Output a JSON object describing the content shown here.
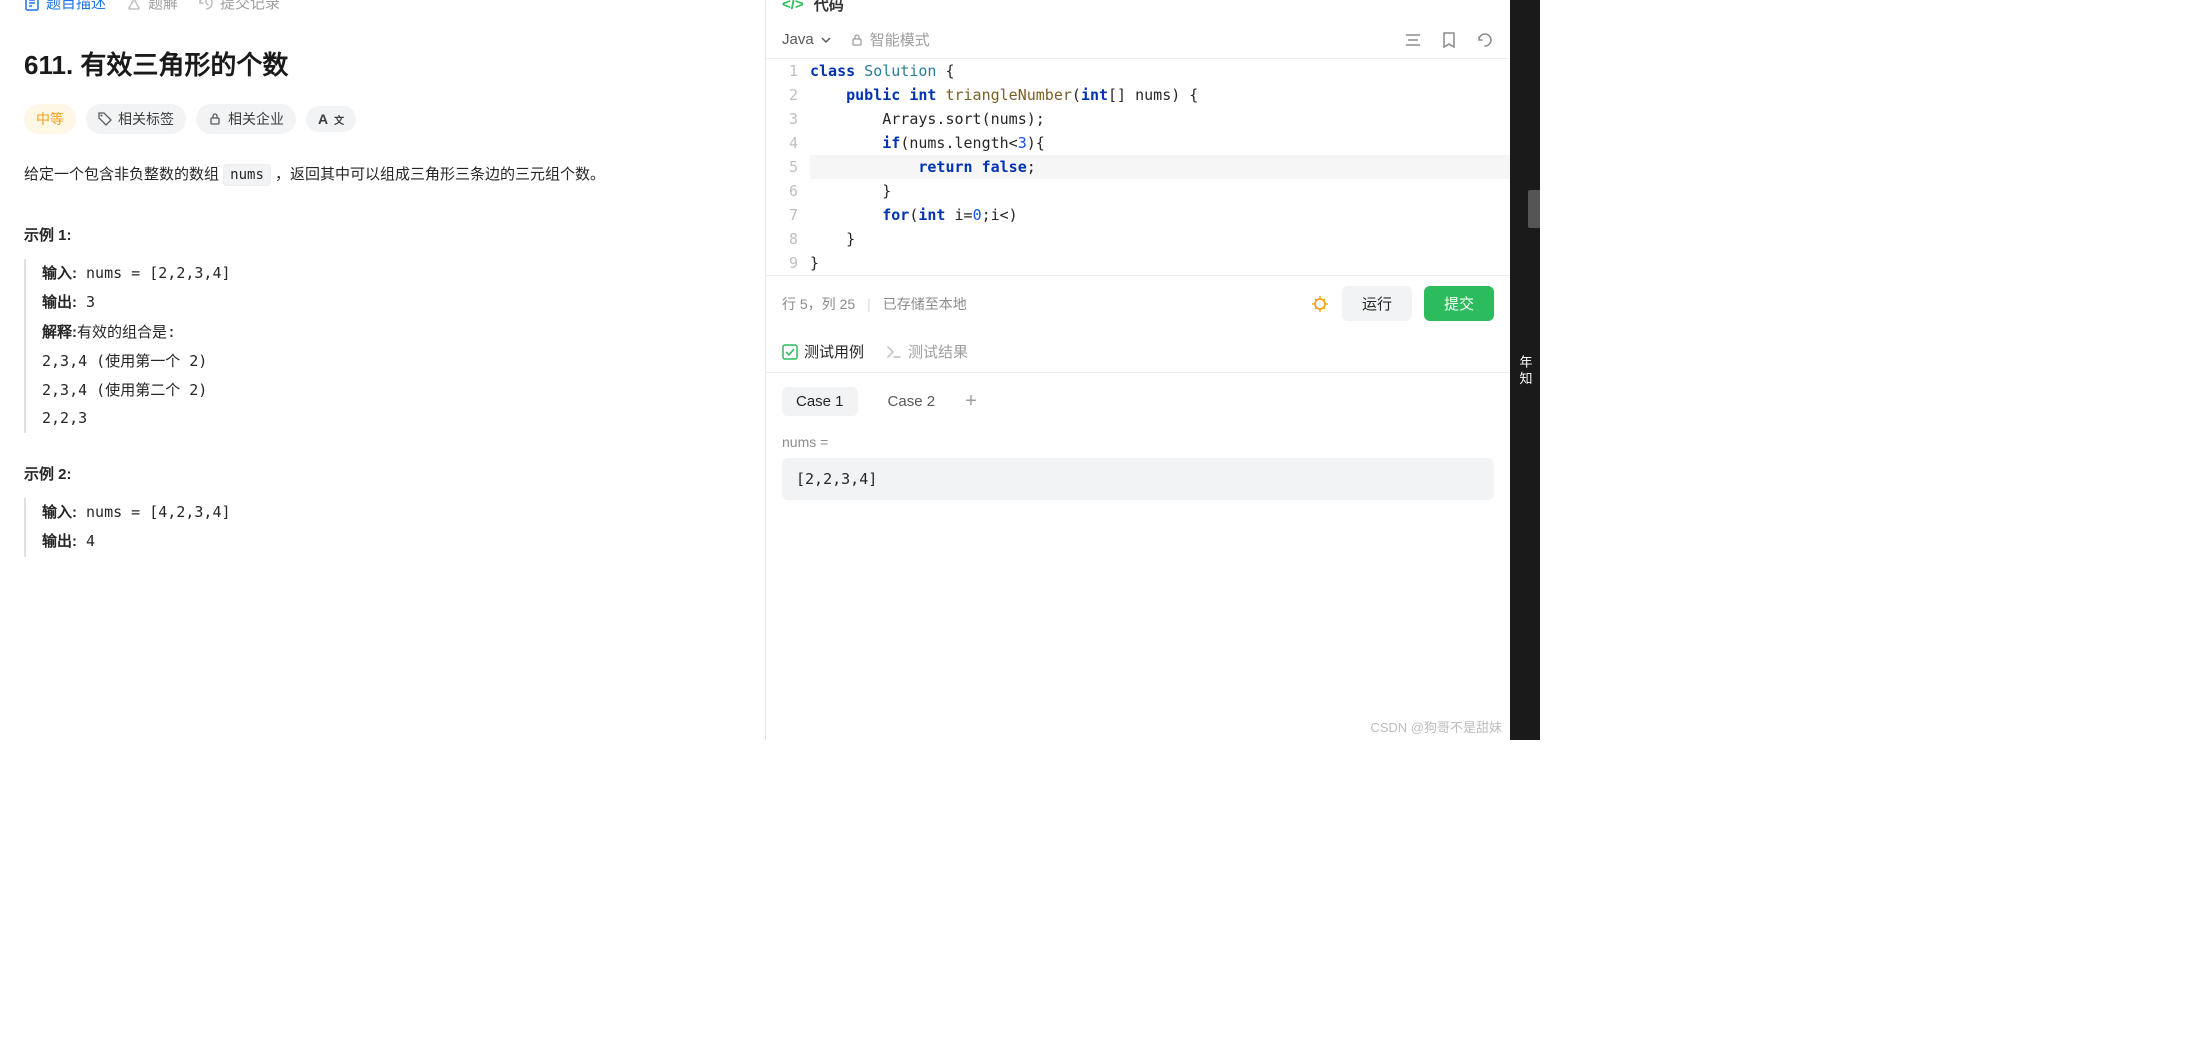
{
  "left": {
    "tabs": {
      "desc": "题目描述",
      "solution": "题解",
      "submissions": "提交记录"
    },
    "title": "611. 有效三角形的个数",
    "chips": {
      "difficulty": "中等",
      "tags": "相关标签",
      "companies": "相关企业",
      "font": "A"
    },
    "desc_prefix": "给定一个包含非负整数的数组 ",
    "desc_code": "nums",
    "desc_suffix": " ，返回其中可以组成三角形三条边的三元组个数。",
    "example1_title": "示例 1:",
    "ex1": {
      "input_label": "输入:",
      "input_val": " nums = [2,2,3,4]",
      "output_label": "输出:",
      "output_val": " 3",
      "explain_label": "解释:",
      "explain_val": "有效的组合是:",
      "l1": "2,3,4 (使用第一个 2)",
      "l2": "2,3,4 (使用第二个 2)",
      "l3": "2,2,3"
    },
    "example2_title": "示例 2:",
    "ex2": {
      "input_label": "输入:",
      "input_val": " nums = [4,2,3,4]",
      "output_label": "输出:",
      "output_val": " 4"
    }
  },
  "right": {
    "code_label": "代码",
    "language": "Java",
    "smart_mode": "智能模式",
    "code": {
      "l1": {
        "p1": "class",
        "p2": " Solution {",
        "cls": ""
      },
      "l2": {
        "p1": "    ",
        "kw1": "public",
        "sp1": " ",
        "kw2": "int",
        "sp2": " ",
        "fn": "triangleNumber",
        "p2": "(",
        "kw3": "int",
        "p3": "[] nums) {"
      },
      "l3": "        Arrays.sort(nums);",
      "l4": {
        "p1": "        ",
        "kw": "if",
        "p2": "(nums.length<",
        "num": "3",
        "p3": "){"
      },
      "l5": {
        "p1": "            ",
        "kw": "return",
        "sp": " ",
        "bool": "false",
        "p2": ";"
      },
      "l6": "        }",
      "l7": {
        "p1": "        ",
        "kw": "for",
        "p2": "(",
        "kw2": "int",
        "p3": " i=",
        "num1": "0",
        "p4": ";i<)"
      },
      "l8": "    }",
      "l9": "}"
    },
    "status": {
      "pos": "行 5，列 25",
      "saved": "已存储至本地"
    },
    "run": "运行",
    "submit": "提交",
    "test_tabs": {
      "cases": "测试用例",
      "results": "测试结果"
    },
    "cases": {
      "c1": "Case 1",
      "c2": "Case 2",
      "input_label": "nums =",
      "input_value": "[2,2,3,4]"
    }
  },
  "sidebar": "年 知",
  "watermark": "CSDN @狗哥不是甜妹"
}
